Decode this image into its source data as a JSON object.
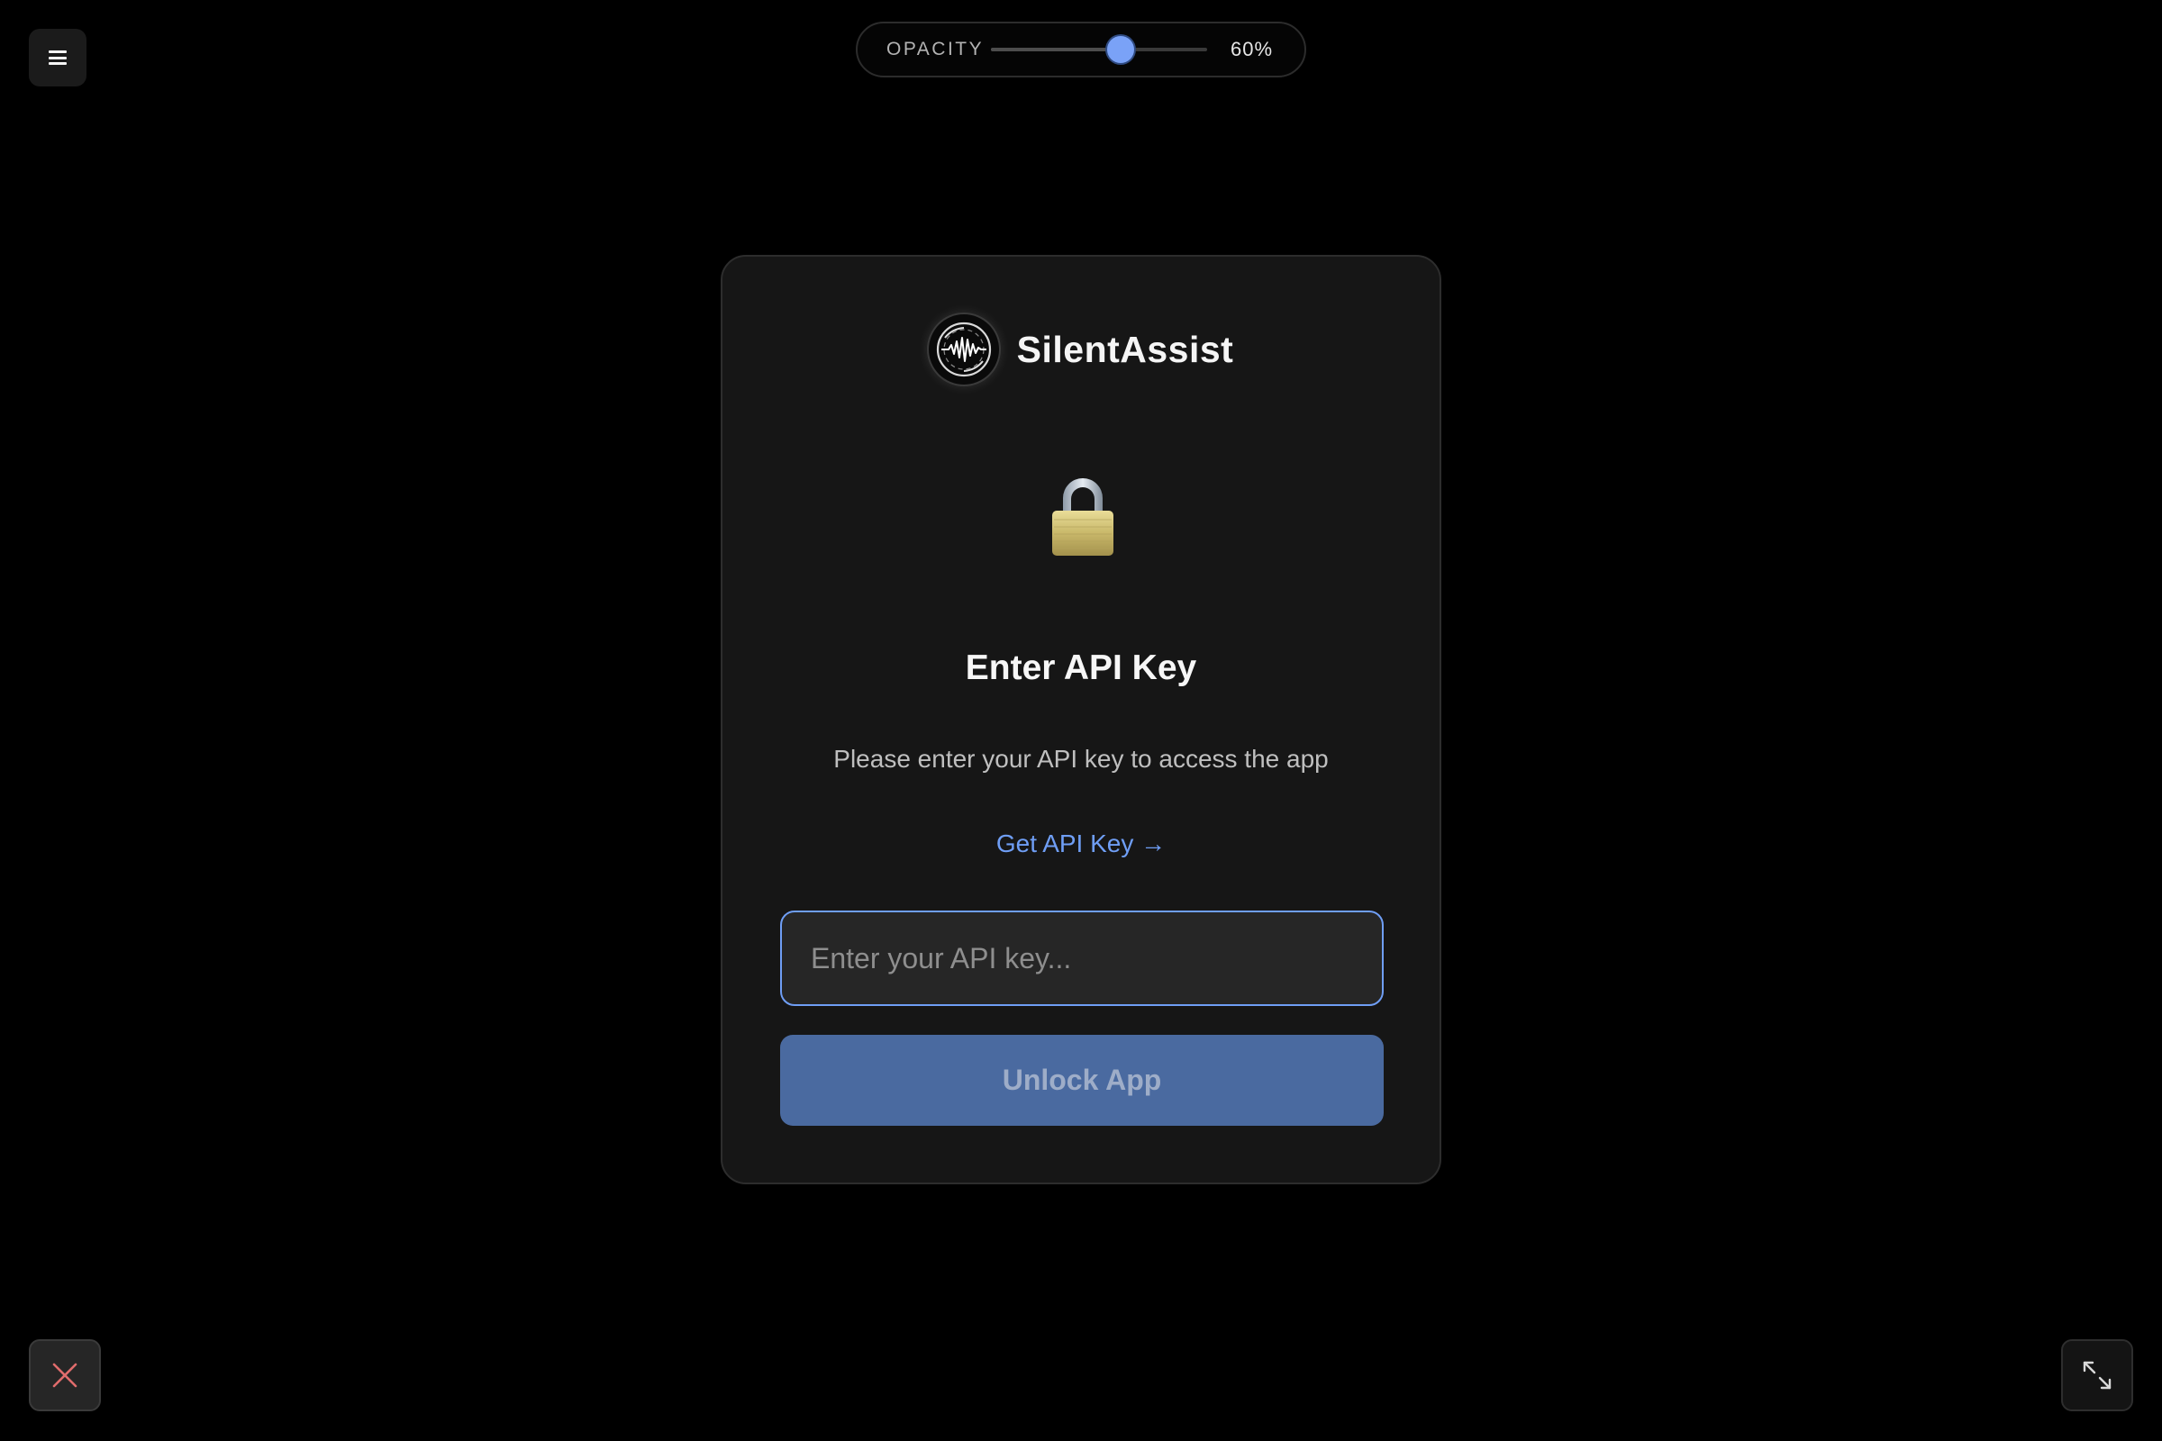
{
  "app": {
    "name": "SilentAssist"
  },
  "toolbar": {
    "opacity_label": "OPACITY",
    "opacity_value": "60%",
    "opacity_fraction": 0.6
  },
  "lock_screen": {
    "title": "Enter API Key",
    "subtitle": "Please enter your API key to access the app",
    "get_key_link": "Get API Key →",
    "input_value": "",
    "input_placeholder": "Enter your API key...",
    "unlock_label": "Unlock App"
  },
  "icons": {
    "menu": "hamburger-icon",
    "logo": "waveform-logo",
    "lock": "padlock-icon",
    "close": "close-icon",
    "expand": "expand-icon"
  },
  "colors": {
    "background": "#000000",
    "card": "#161616",
    "accent": "#6f9ef5",
    "button": "#4a6aa0",
    "close_x": "#e06c6c"
  }
}
